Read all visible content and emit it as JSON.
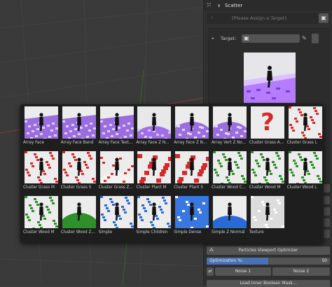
{
  "header": {
    "title": "Scatter",
    "arrows_icon": "move-arrows-icon",
    "collapse_icon": "chevron-down-icon"
  },
  "assign": {
    "placeholder": "[Please Assign a Target]",
    "icon": "group-icon",
    "side_icon": "cube-icon"
  },
  "target": {
    "label": "Target:",
    "value": "",
    "icon": "crosshair-icon",
    "picker_icon": "eyedropper-icon"
  },
  "popup": {
    "presets": [
      {
        "label": "Array Face",
        "theme": "purple-plane"
      },
      {
        "label": "Array Face Band",
        "theme": "purple-plane"
      },
      {
        "label": "Array Face Text...",
        "theme": "purple-plane"
      },
      {
        "label": "Array Face Z N...",
        "theme": "white-sphere"
      },
      {
        "label": "Array Face Z N...",
        "theme": "purple-sphere"
      },
      {
        "label": "Array Vert Z No...",
        "theme": "purple-sphere"
      },
      {
        "label": "Cluster Grass A...",
        "theme": "red-question"
      },
      {
        "label": "Cluster Grass L",
        "theme": "red-patches"
      },
      {
        "label": "Cluster Grass M",
        "theme": "red-patches"
      },
      {
        "label": "Cluster Grass S",
        "theme": "red-patches"
      },
      {
        "label": "Cluster Grass Z...",
        "theme": "red-sphere"
      },
      {
        "label": "Cluster Plant M",
        "theme": "red-cubes"
      },
      {
        "label": "Cluster Plant S",
        "theme": "red-cubes"
      },
      {
        "label": "Cluster Wood C...",
        "theme": "green-patches"
      },
      {
        "label": "Cluster Wood M",
        "theme": "green-patches"
      },
      {
        "label": "Cluster Wood L",
        "theme": "green-patches"
      },
      {
        "label": "Cluster Wood M",
        "theme": "green-patches"
      },
      {
        "label": "Cluster Wood Z...",
        "theme": "green-sphere"
      },
      {
        "label": "Simple",
        "theme": "blue-patches"
      },
      {
        "label": "Simple Children",
        "theme": "blue-patches"
      },
      {
        "label": "Simple Dense",
        "theme": "blue-dense"
      },
      {
        "label": "Simple Z Normal",
        "theme": "blue-sphere"
      },
      {
        "label": "Texture",
        "theme": "white-patches"
      }
    ]
  },
  "particles": {
    "button_label": "Particles Viewport Optimizer",
    "icon": "particles-icon"
  },
  "optimization": {
    "label": "Optimization %:",
    "value": "50",
    "fraction": 0.5
  },
  "noise": {
    "icon": "shuffle-icon",
    "noise1": "Noise 1",
    "noise2": "Noise 2"
  },
  "bottom": {
    "label": "Load Inner Boolean Mask..."
  },
  "colors": {
    "accent": "#4772b3",
    "purple": "#9b6ee0",
    "red": "#d62a2a",
    "green": "#2f8f2a",
    "blue": "#2a6ad6"
  }
}
